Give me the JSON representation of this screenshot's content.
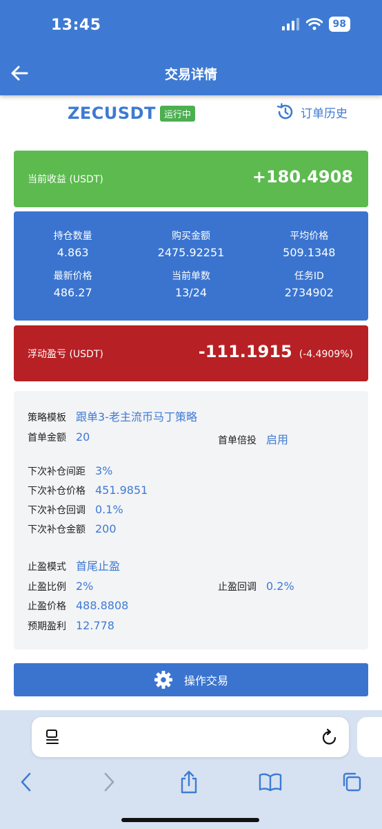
{
  "status_bar": {
    "time": "13:45",
    "battery": "98"
  },
  "header": {
    "title": "交易详情"
  },
  "symbol_row": {
    "symbol": "ZECUSDT",
    "status_badge": "运行中",
    "order_history": "订单历史"
  },
  "income_card": {
    "label": "当前收益 (USDT)",
    "value": "+180.4908"
  },
  "stats": [
    {
      "label": "持仓数量",
      "value": "4.863"
    },
    {
      "label": "购买金额",
      "value": "2475.92251"
    },
    {
      "label": "平均价格",
      "value": "509.1348"
    },
    {
      "label": "最新价格",
      "value": "486.27"
    },
    {
      "label": "当前单数",
      "value": "13/24"
    },
    {
      "label": "任务ID",
      "value": "2734902"
    }
  ],
  "float_card": {
    "label": "浮动盈亏 (USDT)",
    "value": "-111.1915",
    "percent": "(-4.4909%)"
  },
  "params": {
    "strategy_template": {
      "label": "策略模板",
      "value": "跟单3-老主流币马丁策略"
    },
    "first_amount": {
      "label": "首单金额",
      "value": "20"
    },
    "first_multiplier": {
      "label": "首单倍投",
      "value": "启用"
    },
    "next_spacing": {
      "label": "下次补仓间距",
      "value": "3%"
    },
    "next_price": {
      "label": "下次补仓价格",
      "value": "451.9851"
    },
    "next_pullback": {
      "label": "下次补仓回调",
      "value": "0.1%"
    },
    "next_amount": {
      "label": "下次补仓金额",
      "value": "200"
    },
    "tp_mode": {
      "label": "止盈模式",
      "value": "首尾止盈"
    },
    "tp_ratio": {
      "label": "止盈比例",
      "value": "2%"
    },
    "tp_pullback": {
      "label": "止盈回调",
      "value": "0.2%"
    },
    "tp_price": {
      "label": "止盈价格",
      "value": "488.8808"
    },
    "expected_profit": {
      "label": "预期盈利",
      "value": "12.778"
    }
  },
  "action_button": {
    "label": "操作交易"
  },
  "colors": {
    "primary": "#3e7ad3",
    "income_green": "#5cba4f",
    "loss_red": "#b72024",
    "badge_green": "#4caf50"
  },
  "icons": [
    "back-arrow-icon",
    "signal-icon",
    "wifi-icon",
    "history-icon",
    "gear-icon",
    "tabs-icon",
    "reload-icon",
    "share-icon",
    "bookmarks-icon",
    "windows-icon"
  ]
}
